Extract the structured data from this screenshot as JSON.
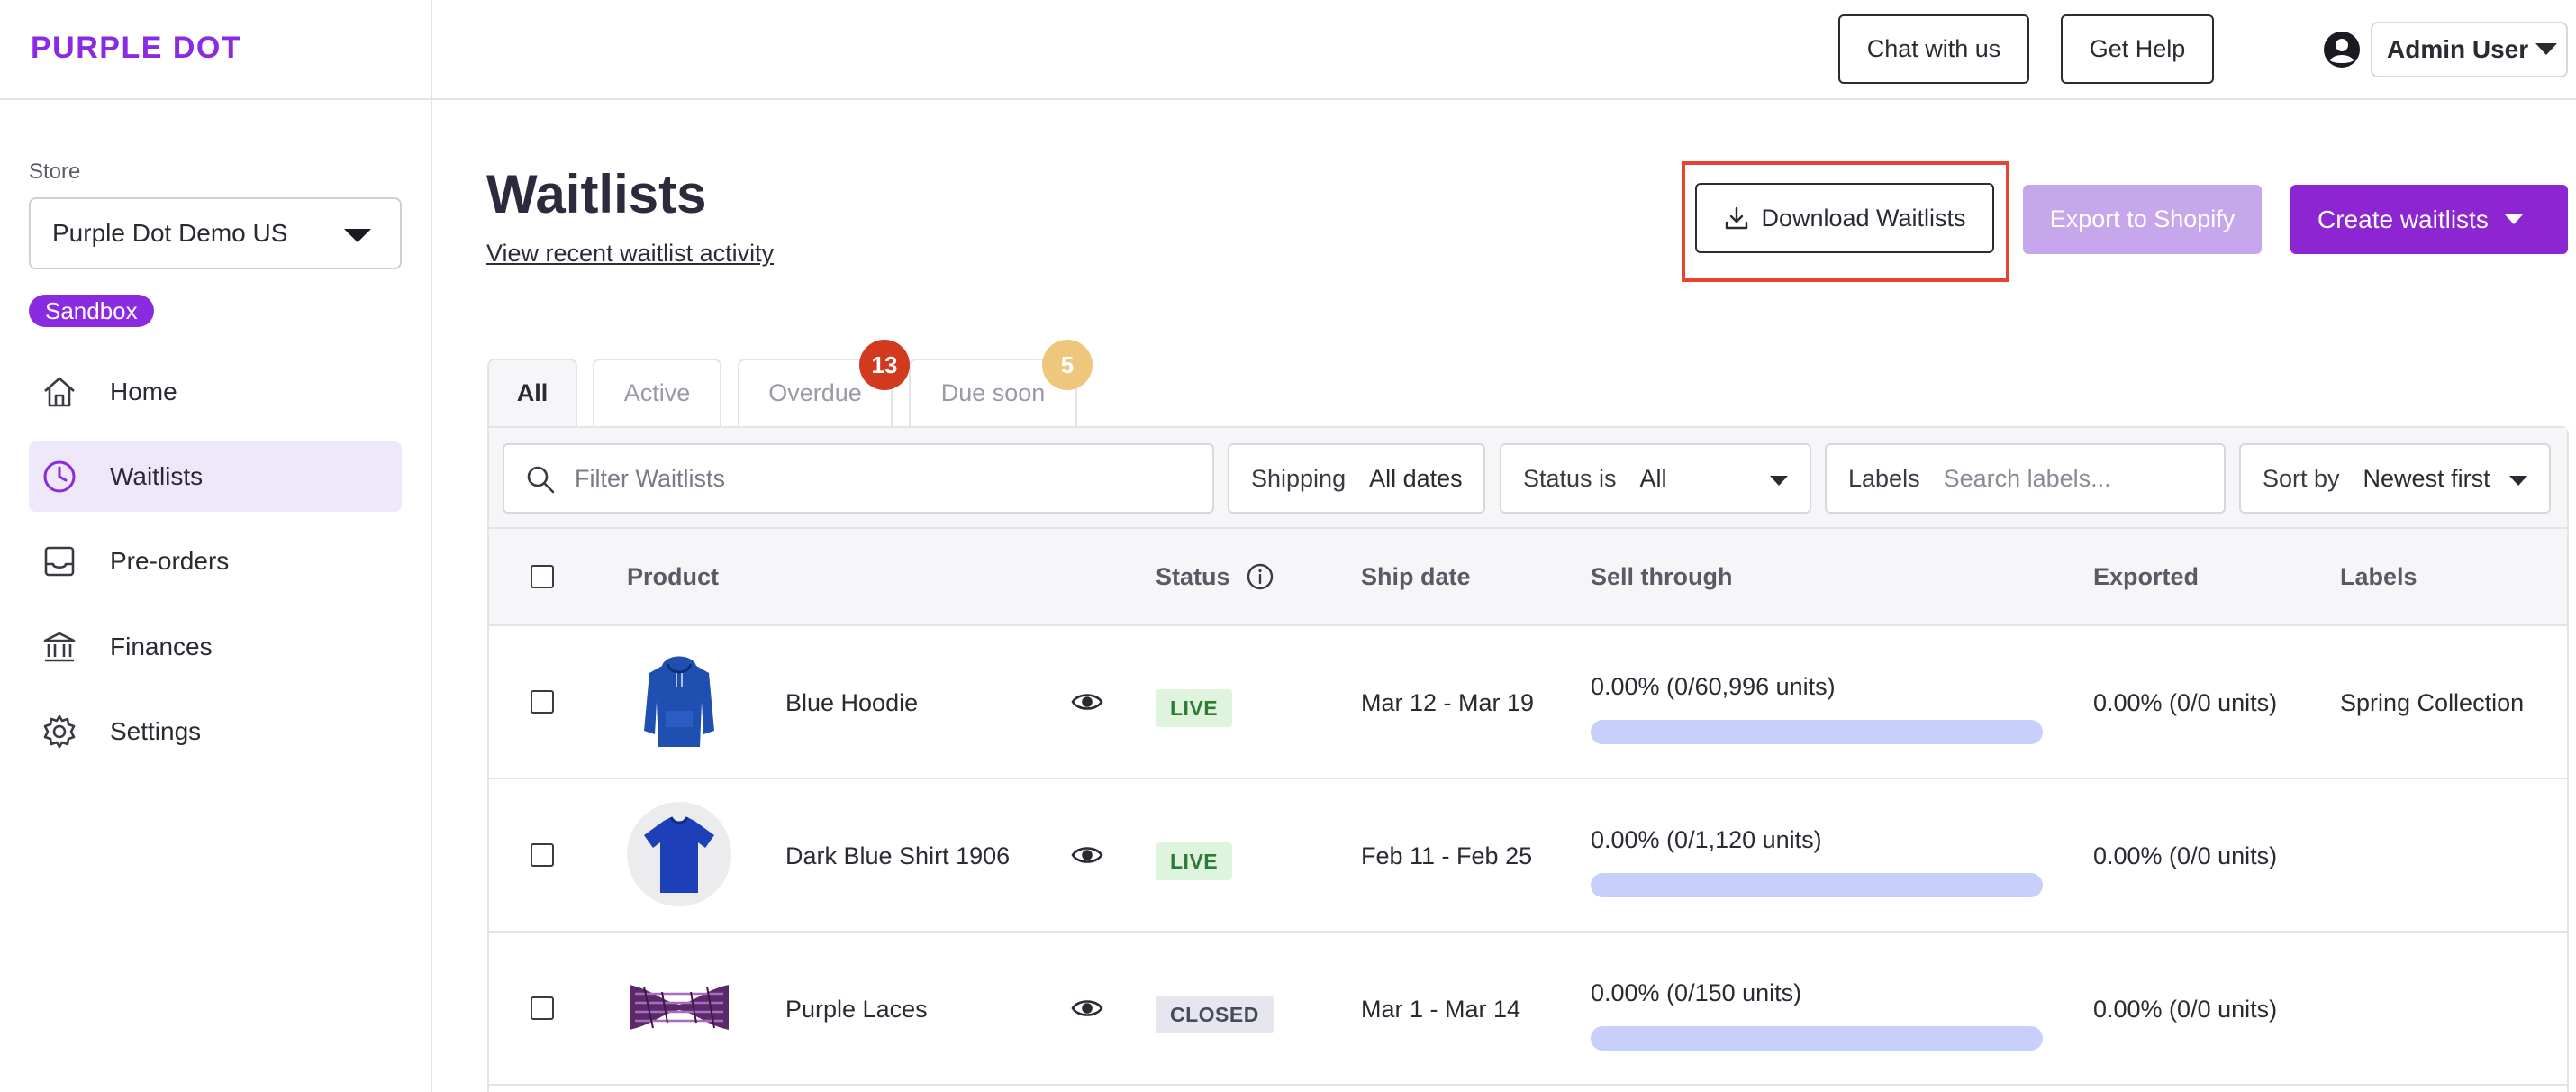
{
  "app": {
    "logo": "PURPLE DOT"
  },
  "header": {
    "chat_label": "Chat with us",
    "help_label": "Get Help",
    "user_name": "Admin User"
  },
  "sidebar": {
    "store_label": "Store",
    "store_value": "Purple Dot Demo US",
    "environment_badge": "Sandbox",
    "items": [
      {
        "label": "Home",
        "icon": "home-icon"
      },
      {
        "label": "Waitlists",
        "icon": "clock-icon",
        "active": true
      },
      {
        "label": "Pre-orders",
        "icon": "inbox-icon"
      },
      {
        "label": "Finances",
        "icon": "bank-icon"
      },
      {
        "label": "Settings",
        "icon": "gear-icon"
      }
    ]
  },
  "page": {
    "title": "Waitlists",
    "activity_link": "View recent waitlist activity",
    "download_label": "Download Waitlists",
    "export_label": "Export to Shopify",
    "create_label": "Create waitlists"
  },
  "tabs": [
    {
      "label": "All",
      "active": true
    },
    {
      "label": "Active"
    },
    {
      "label": "Overdue",
      "count": "13"
    },
    {
      "label": "Due soon",
      "count": "5"
    }
  ],
  "filters": {
    "search_placeholder": "Filter Waitlists",
    "shipping_label": "Shipping",
    "shipping_value": "All dates",
    "status_label": "Status is",
    "status_value": "All",
    "labels_label": "Labels",
    "labels_placeholder": "Search labels...",
    "sort_label": "Sort by",
    "sort_value": "Newest first"
  },
  "table": {
    "columns": [
      "Product",
      "Status",
      "Ship date",
      "Sell through",
      "Exported",
      "Labels"
    ],
    "rows": [
      {
        "product": "Blue Hoodie",
        "status": "LIVE",
        "ship_date": "Mar 12 - Mar 19",
        "sell_through": "0.00% (0/60,996 units)",
        "sell_through_fraction": 0,
        "exported": "0.00% (0/0 units)",
        "labels": "Spring Collection"
      },
      {
        "product": "Dark Blue Shirt 1906",
        "status": "LIVE",
        "ship_date": "Feb 11 - Feb 25",
        "sell_through": "0.00% (0/1,120 units)",
        "sell_through_fraction": 0,
        "exported": "0.00% (0/0 units)",
        "labels": ""
      },
      {
        "product": "Purple Laces",
        "status": "CLOSED",
        "ship_date": "Mar 1 - Mar 14",
        "sell_through": "0.00% (0/150 units)",
        "sell_through_fraction": 0,
        "exported": "0.00% (0/0 units)",
        "labels": ""
      }
    ]
  },
  "colors": {
    "brand": "#8a2be2",
    "primary_button": "#8e25d3",
    "highlight": "#e8432f",
    "overdue": "#d13a1f",
    "due_soon": "#efc77c"
  }
}
